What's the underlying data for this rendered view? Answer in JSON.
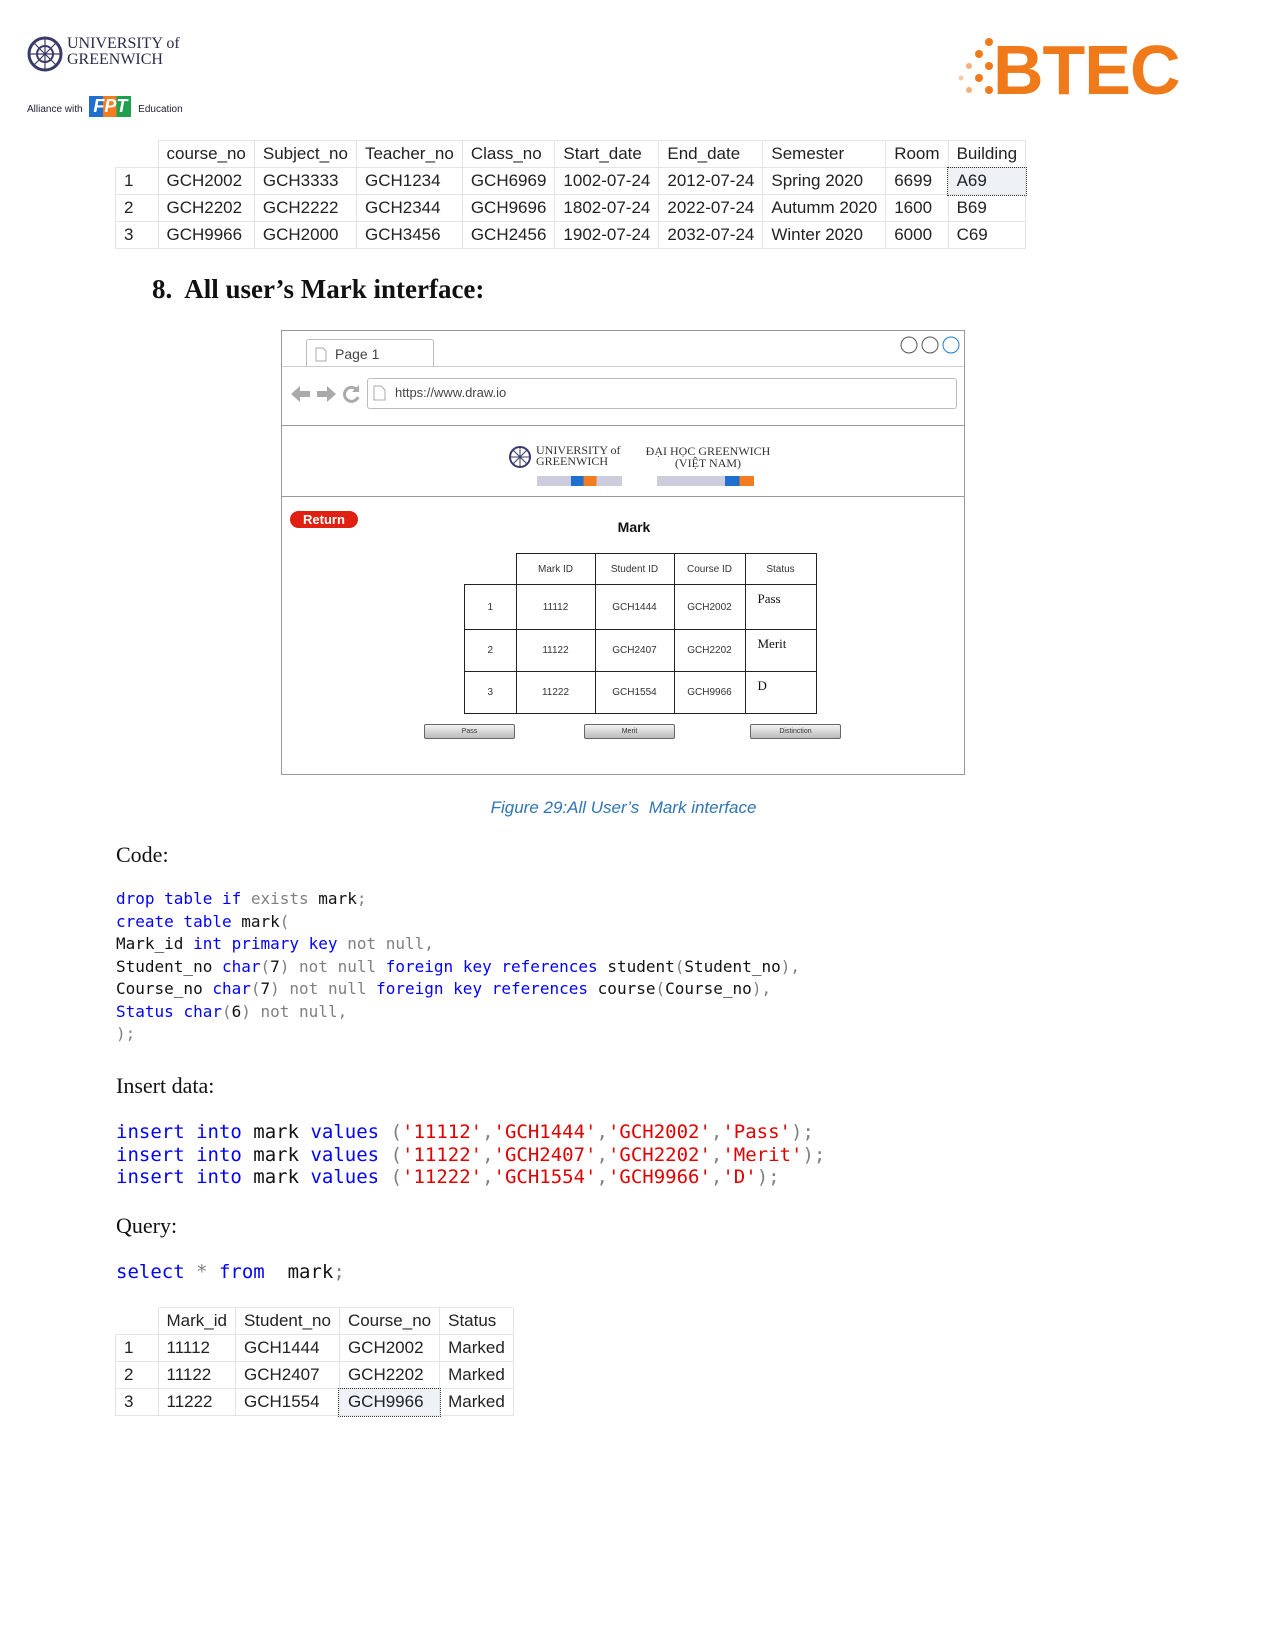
{
  "header": {
    "uni_logo": "UNIVERSITY of GREENWICH",
    "alliance": "Alliance with",
    "fpt": "FPT",
    "education": "Education",
    "btec_logo": "BTEC"
  },
  "course_table": {
    "columns": [
      "",
      "course_no",
      "Subject_no",
      "Teacher_no",
      "Class_no",
      "Start_date",
      "End_date",
      "Semester",
      "Room",
      "Building"
    ],
    "rows": [
      [
        "1",
        "GCH2002",
        "GCH3333",
        "GCH1234",
        "GCH6969",
        "1002-07-24",
        "2012-07-24",
        "Spring 2020",
        "6699",
        "A69"
      ],
      [
        "2",
        "GCH2202",
        "GCH2222",
        "GCH2344",
        "GCH9696",
        "1802-07-24",
        "2022-07-24",
        "Autumm 2020",
        "1600",
        "B69"
      ],
      [
        "3",
        "GCH9966",
        "GCH2000",
        "GCH3456",
        "GCH2456",
        "1902-07-24",
        "2032-07-24",
        "Winter 2020",
        "6000",
        "C69"
      ]
    ]
  },
  "section_heading": "8.  All user’s Mark interface:",
  "mockup": {
    "tab_label": "Page 1",
    "url": "https://www.draw.io",
    "logo_left": "UNIVERSITY of GREENWICH",
    "logo_right_line1": "ĐẠI HỌC GREENWICH",
    "logo_right_line2": "(VIỆT NAM)",
    "return_label": "Return",
    "title": "Mark",
    "columns": [
      "Mark ID",
      "Student ID",
      "Course ID",
      "Status"
    ],
    "rows": [
      [
        "1",
        "11112",
        "GCH1444",
        "GCH2002",
        "Pass"
      ],
      [
        "2",
        "11122",
        "GCH2407",
        "GCH2202",
        "Merit"
      ],
      [
        "3",
        "11222",
        "GCH1554",
        "GCH9966",
        "D"
      ]
    ],
    "buttons": [
      "Pass",
      "Merit",
      "Distinction"
    ]
  },
  "caption": "Figure 29:All User’s  Mark interface",
  "code_label": "Code:",
  "code": [
    [
      {
        "t": "drop table if ",
        "k": "kw"
      },
      {
        "t": "exists ",
        "k": "gray"
      },
      {
        "t": "mark",
        "k": "plain"
      },
      {
        "t": ";",
        "k": "gray"
      }
    ],
    [
      {
        "t": "create table ",
        "k": "kw"
      },
      {
        "t": "mark",
        "k": "plain"
      },
      {
        "t": "(",
        "k": "gray"
      }
    ],
    [
      {
        "t": "Mark_id ",
        "k": "plain"
      },
      {
        "t": "int primary key ",
        "k": "kw"
      },
      {
        "t": "not null,",
        "k": "gray"
      }
    ],
    [
      {
        "t": "Student_no ",
        "k": "plain"
      },
      {
        "t": "char",
        "k": "kw"
      },
      {
        "t": "(",
        "k": "gray"
      },
      {
        "t": "7",
        "k": "plain"
      },
      {
        "t": ") not null ",
        "k": "gray"
      },
      {
        "t": "foreign key references ",
        "k": "kw"
      },
      {
        "t": "student",
        "k": "plain"
      },
      {
        "t": "(",
        "k": "gray"
      },
      {
        "t": "Student_no",
        "k": "plain"
      },
      {
        "t": "),",
        "k": "gray"
      }
    ],
    [
      {
        "t": "Course_no ",
        "k": "plain"
      },
      {
        "t": "char",
        "k": "kw"
      },
      {
        "t": "(",
        "k": "gray"
      },
      {
        "t": "7",
        "k": "plain"
      },
      {
        "t": ") not null ",
        "k": "gray"
      },
      {
        "t": "foreign key references ",
        "k": "kw"
      },
      {
        "t": "course",
        "k": "plain"
      },
      {
        "t": "(",
        "k": "gray"
      },
      {
        "t": "Course_no",
        "k": "plain"
      },
      {
        "t": "),",
        "k": "gray"
      }
    ],
    [
      {
        "t": "Status ",
        "k": "kw"
      },
      {
        "t": "char",
        "k": "kw"
      },
      {
        "t": "(",
        "k": "gray"
      },
      {
        "t": "6",
        "k": "plain"
      },
      {
        "t": ") not null,",
        "k": "gray"
      }
    ],
    [
      {
        "t": ");",
        "k": "gray"
      }
    ]
  ],
  "insert_label": "Insert data:",
  "inserts": [
    [
      {
        "t": "insert into ",
        "k": "kw"
      },
      {
        "t": "mark ",
        "k": "plain"
      },
      {
        "t": "values ",
        "k": "kw"
      },
      {
        "t": "(",
        "k": "gray"
      },
      {
        "t": "'11112'",
        "k": "str"
      },
      {
        "t": ",",
        "k": "gray"
      },
      {
        "t": "'GCH1444'",
        "k": "str"
      },
      {
        "t": ",",
        "k": "gray"
      },
      {
        "t": "'GCH2002'",
        "k": "str"
      },
      {
        "t": ",",
        "k": "gray"
      },
      {
        "t": "'Pass'",
        "k": "str"
      },
      {
        "t": ");",
        "k": "gray"
      }
    ],
    [
      {
        "t": "insert into ",
        "k": "kw"
      },
      {
        "t": "mark ",
        "k": "plain"
      },
      {
        "t": "values ",
        "k": "kw"
      },
      {
        "t": "(",
        "k": "gray"
      },
      {
        "t": "'11122'",
        "k": "str"
      },
      {
        "t": ",",
        "k": "gray"
      },
      {
        "t": "'GCH2407'",
        "k": "str"
      },
      {
        "t": ",",
        "k": "gray"
      },
      {
        "t": "'GCH2202'",
        "k": "str"
      },
      {
        "t": ",",
        "k": "gray"
      },
      {
        "t": "'Merit'",
        "k": "str"
      },
      {
        "t": ");",
        "k": "gray"
      }
    ],
    [
      {
        "t": "insert into ",
        "k": "kw"
      },
      {
        "t": "mark ",
        "k": "plain"
      },
      {
        "t": "values ",
        "k": "kw"
      },
      {
        "t": "(",
        "k": "gray"
      },
      {
        "t": "'11222'",
        "k": "str"
      },
      {
        "t": ",",
        "k": "gray"
      },
      {
        "t": "'GCH1554'",
        "k": "str"
      },
      {
        "t": ",",
        "k": "gray"
      },
      {
        "t": "'GCH9966'",
        "k": "str"
      },
      {
        "t": ",",
        "k": "gray"
      },
      {
        "t": "'D'",
        "k": "str"
      },
      {
        "t": ");",
        "k": "gray"
      }
    ]
  ],
  "query_label": "Query:",
  "query": [
    {
      "t": "select ",
      "k": "kw"
    },
    {
      "t": "* ",
      "k": "gray"
    },
    {
      "t": "from  ",
      "k": "kw"
    },
    {
      "t": "mark",
      "k": "plain"
    },
    {
      "t": ";",
      "k": "gray"
    }
  ],
  "result_table": {
    "columns": [
      "",
      "Mark_id",
      "Student_no",
      "Course_no",
      "Status"
    ],
    "rows": [
      [
        "1",
        "11112",
        "GCH1444",
        "GCH2002",
        "Marked"
      ],
      [
        "2",
        "11122",
        "GCH2407",
        "GCH2202",
        "Marked"
      ],
      [
        "3",
        "11222",
        "GCH1554",
        "GCH9966",
        "Marked"
      ]
    ]
  },
  "colors": {
    "keyword": "#0000ff",
    "string": "#e00000",
    "comment_gray": "#808080",
    "caption": "#2e74b5",
    "return_button": "#e02010",
    "btec": "#f07a1a"
  }
}
